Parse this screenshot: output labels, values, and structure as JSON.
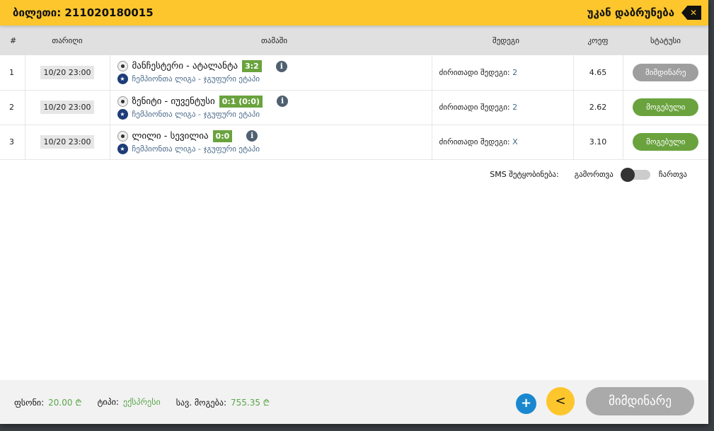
{
  "header": {
    "ticket": "ბილეთი: 211020180015",
    "back_label": "უკან დაბრუნება"
  },
  "columns": [
    "#",
    "თარიღი",
    "თამაში",
    "შედეგი",
    "კოეფ",
    "სტატუსი"
  ],
  "rows": [
    {
      "num": "1",
      "date": "10/20 23:00",
      "match": "მანჩესტერი - ატალანტა",
      "score": "3:2",
      "league": "ჩემპიონთა ლიგა - ჯგუფური ეტაპი",
      "result_label": "ძირითადი შედეგი:",
      "pick": "2",
      "coef": "4.65",
      "status": "მიმდინარე",
      "status_color": "#9e9e9e"
    },
    {
      "num": "2",
      "date": "10/20 23:00",
      "match": "ზენიტი - იუვენტუსი",
      "score": "0:1 (0:0)",
      "league": "ჩემპიონთა ლიგა - ჯგუფური ეტაპი",
      "result_label": "ძირითადი შედეგი:",
      "pick": "2",
      "coef": "2.62",
      "status": "მოგებული",
      "status_color": "#6aa33e"
    },
    {
      "num": "3",
      "date": "10/20 23:00",
      "match": "ლილი - სევილია",
      "score": "0:0",
      "league": "ჩემპიონთა ლიგა - ჯგუფური ეტაპი",
      "result_label": "ძირითადი შედეგი:",
      "pick": "X",
      "coef": "3.10",
      "status": "მოგებული",
      "status_color": "#6aa33e"
    }
  ],
  "sms": {
    "label": "SMS შეტყობინება:",
    "off": "გამორთვა",
    "on": "ჩართვა",
    "enabled": false
  },
  "footer": {
    "stake_label": "ფსონი:",
    "stake": "20.00 ₾",
    "type_label": "ტიპი:",
    "type": "ექსპრესი",
    "max_win_label": "სავ. მოგება:",
    "max_win": "755.35 ₾",
    "status_button": "მიმდინარე"
  }
}
